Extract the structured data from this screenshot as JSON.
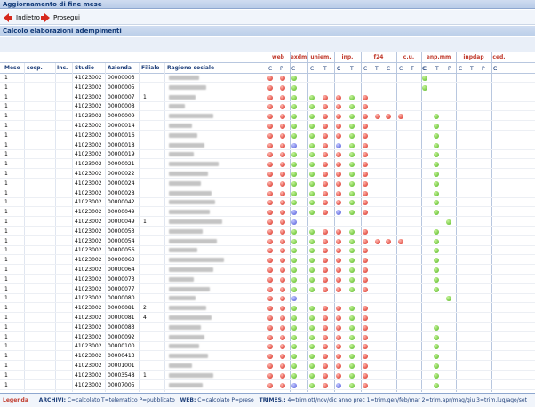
{
  "window": {
    "title": "Aggiornamento di fine mese"
  },
  "toolbar": {
    "back_label": "Indietro",
    "next_label": "Prosegui"
  },
  "section": {
    "title": "Calcolo elaborazioni adempimenti"
  },
  "columns": {
    "mese": "Mese",
    "sosp": "sosp.",
    "inc": "Inc.",
    "studio": "Studio",
    "azienda": "Azienda",
    "filiale": "Filiale",
    "ragione": "Ragione sociale"
  },
  "groups": [
    {
      "label": "web",
      "subs": [
        "C",
        "P",
        "C"
      ]
    },
    {
      "label": "exdm",
      "subs": []
    },
    {
      "label": "uniem.",
      "subs": [
        "C",
        "T",
        "C"
      ]
    },
    {
      "label": "inp.",
      "subs": [
        "C",
        "T"
      ]
    },
    {
      "label": "f24",
      "subs": [
        "C",
        "T",
        "C"
      ]
    },
    {
      "label": "c.u.",
      "subs": [
        "C",
        "T",
        "C"
      ]
    },
    {
      "label": "enp.mm",
      "subs": [
        "C",
        "T",
        "P"
      ]
    },
    {
      "label": "inpdap",
      "subs": [
        "C",
        "T",
        "P",
        "C"
      ]
    },
    {
      "label": "ced.",
      "subs": [
        "C"
      ]
    }
  ],
  "rows": [
    {
      "mese": "1",
      "studio": "41023002",
      "azienda": "00000003",
      "filiale": "",
      "dots": "rrg.........g"
    },
    {
      "mese": "1",
      "studio": "41023002",
      "azienda": "00000005",
      "filiale": "",
      "dots": "rrg.........g"
    },
    {
      "mese": "1",
      "studio": "41023002",
      "azienda": "00000007",
      "filiale": "1",
      "dots": "rrggrrgr....."
    },
    {
      "mese": "1",
      "studio": "41023002",
      "azienda": "00000008",
      "filiale": "",
      "dots": "rrggrrgr....."
    },
    {
      "mese": "1",
      "studio": "41023002",
      "azienda": "00000009",
      "filiale": "",
      "dots": "rrggrrgrrrr..g"
    },
    {
      "mese": "1",
      "studio": "41023002",
      "azienda": "00000014",
      "filiale": "",
      "dots": "rrggrrgr.....g"
    },
    {
      "mese": "1",
      "studio": "41023002",
      "azienda": "00000016",
      "filiale": "",
      "dots": "rrggrrgr.....g"
    },
    {
      "mese": "1",
      "studio": "41023002",
      "azienda": "00000018",
      "filiale": "",
      "dots": "rrbgrbgr.....g"
    },
    {
      "mese": "1",
      "studio": "41023002",
      "azienda": "00000019",
      "filiale": "",
      "dots": "rrggrrgr.....g"
    },
    {
      "mese": "1",
      "studio": "41023002",
      "azienda": "00000021",
      "filiale": "",
      "dots": "rrggrrgr.....g"
    },
    {
      "mese": "1",
      "studio": "41023002",
      "azienda": "00000022",
      "filiale": "",
      "dots": "rrggrrgr.....g"
    },
    {
      "mese": "1",
      "studio": "41023002",
      "azienda": "00000024",
      "filiale": "",
      "dots": "rrggrrgr.....g"
    },
    {
      "mese": "1",
      "studio": "41023002",
      "azienda": "00000028",
      "filiale": "",
      "dots": "rrggrrgr.....g"
    },
    {
      "mese": "1",
      "studio": "41023002",
      "azienda": "00000042",
      "filiale": "",
      "dots": "rrggrrgr.....g"
    },
    {
      "mese": "1",
      "studio": "41023002",
      "azienda": "00000049",
      "filiale": "",
      "dots": "rrbgrbgr.....g"
    },
    {
      "mese": "1",
      "studio": "41023002",
      "azienda": "00000049",
      "filiale": "1",
      "dots": "rrb...........g"
    },
    {
      "mese": "1",
      "studio": "41023002",
      "azienda": "00000053",
      "filiale": "",
      "dots": "rrggrrgr.....g"
    },
    {
      "mese": "1",
      "studio": "41023002",
      "azienda": "00000054",
      "filiale": "",
      "dots": "rrggrrgrrrr..g"
    },
    {
      "mese": "1",
      "studio": "41023002",
      "azienda": "00000056",
      "filiale": "",
      "dots": "rrggrrgr.....g"
    },
    {
      "mese": "1",
      "studio": "41023002",
      "azienda": "00000063",
      "filiale": "",
      "dots": "rrggrrgr.....g"
    },
    {
      "mese": "1",
      "studio": "41023002",
      "azienda": "00000064",
      "filiale": "",
      "dots": "rrggrrgr.....g"
    },
    {
      "mese": "1",
      "studio": "41023002",
      "azienda": "00000073",
      "filiale": "",
      "dots": "rrggrrgr.....g"
    },
    {
      "mese": "1",
      "studio": "41023002",
      "azienda": "00000077",
      "filiale": "",
      "dots": "rrggrrgr.....g"
    },
    {
      "mese": "1",
      "studio": "41023002",
      "azienda": "00000080",
      "filiale": "",
      "dots": "rrb...........g"
    },
    {
      "mese": "1",
      "studio": "41023002",
      "azienda": "00000081",
      "filiale": "2",
      "dots": "rrggrrgr....."
    },
    {
      "mese": "1",
      "studio": "41023002",
      "azienda": "00000081",
      "filiale": "4",
      "dots": "rrggrrgr....."
    },
    {
      "mese": "1",
      "studio": "41023002",
      "azienda": "00000083",
      "filiale": "",
      "dots": "rrggrrgr.....g"
    },
    {
      "mese": "1",
      "studio": "41023002",
      "azienda": "00000092",
      "filiale": "",
      "dots": "rrggrrgr.....g"
    },
    {
      "mese": "1",
      "studio": "41023002",
      "azienda": "00000100",
      "filiale": "",
      "dots": "rrggrrgr.....g"
    },
    {
      "mese": "1",
      "studio": "41023002",
      "azienda": "00000413",
      "filiale": "",
      "dots": "rrggrrgr.....g"
    },
    {
      "mese": "1",
      "studio": "41023002",
      "azienda": "00001001",
      "filiale": "",
      "dots": "rrggrrgr.....g"
    },
    {
      "mese": "1",
      "studio": "41023002",
      "azienda": "00003548",
      "filiale": "1",
      "dots": "rrggrrgr.....g"
    },
    {
      "mese": "1",
      "studio": "41023002",
      "azienda": "00007005",
      "filiale": "",
      "dots": "rrbgrbgr.....g"
    }
  ],
  "legend": {
    "title": "Legenda",
    "archivi_key": "ARCHIVI:",
    "archivi_text": "C=calcolato T=telematico P=pubblicato",
    "web_key": "WEB:",
    "web_text": "C=calcolato P=preso",
    "trimes_key": "TRIMES.:",
    "trimes_text": "4=trim.ott/nov/dic anno prec 1=trim.gen/feb/mar 2=trim.apr/mag/giu 3=trim.lug/ago/set"
  },
  "colors": {
    "green": "#55b820",
    "red": "#d6291d",
    "blue": "#4d57d8",
    "accent": "#123a78"
  }
}
